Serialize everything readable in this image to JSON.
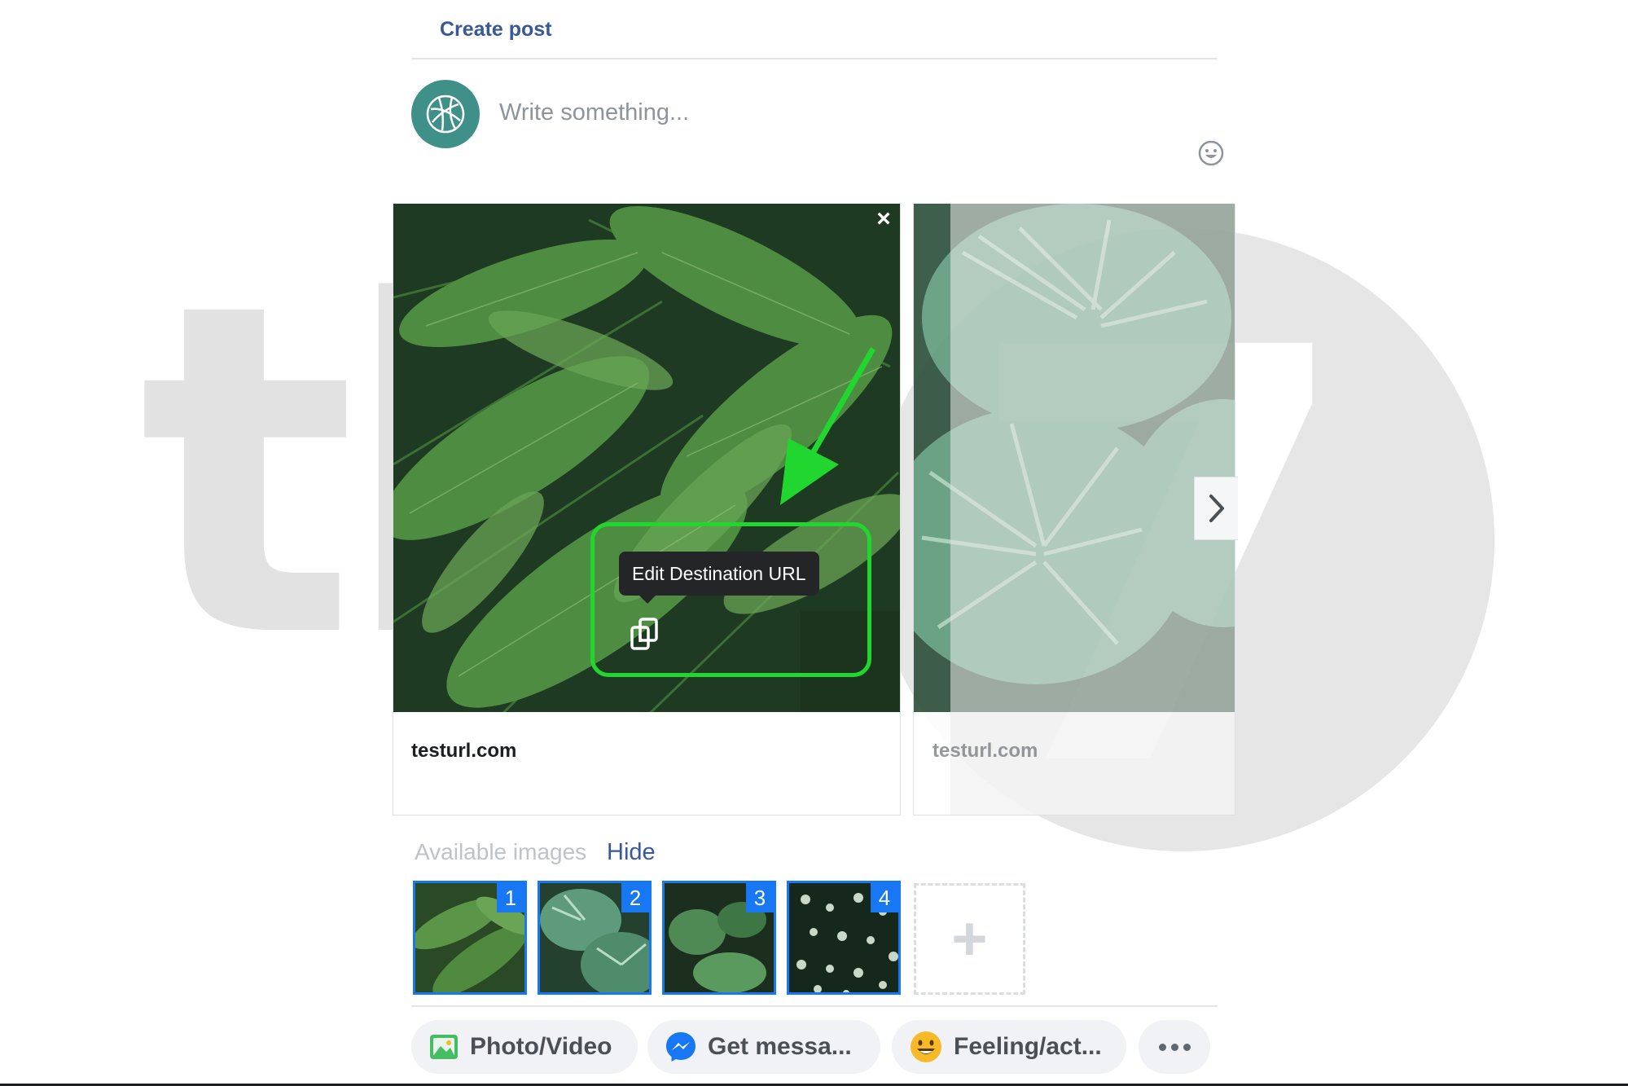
{
  "header": {
    "title": "Create post"
  },
  "composer": {
    "placeholder": "Write something...",
    "avatar_icon": "leaf-logo-icon",
    "emoji_icon": "smiley-icon"
  },
  "carousel": {
    "cards": [
      {
        "url": "testurl.com",
        "image": "palm-fronds",
        "remove_icon": "close-icon"
      },
      {
        "url": "testurl.com",
        "image": "calathea-leaves"
      }
    ],
    "tooltip": "Edit Destination URL",
    "edit_icon": "copy-link-icon",
    "next_icon": "chevron-right-icon"
  },
  "available_images": {
    "label": "Available images",
    "toggle": "Hide",
    "thumbnails": [
      "1",
      "2",
      "3",
      "4"
    ],
    "add_label": "+"
  },
  "actions": [
    {
      "label": "Photo/Video",
      "icon": "photo-icon"
    },
    {
      "label": "Get messa...",
      "icon": "messenger-icon"
    },
    {
      "label": "Feeling/act...",
      "icon": "smiley-emoji-icon"
    }
  ],
  "colors": {
    "link": "#385898",
    "accent": "#1877f2",
    "annotation": "#22d630"
  }
}
